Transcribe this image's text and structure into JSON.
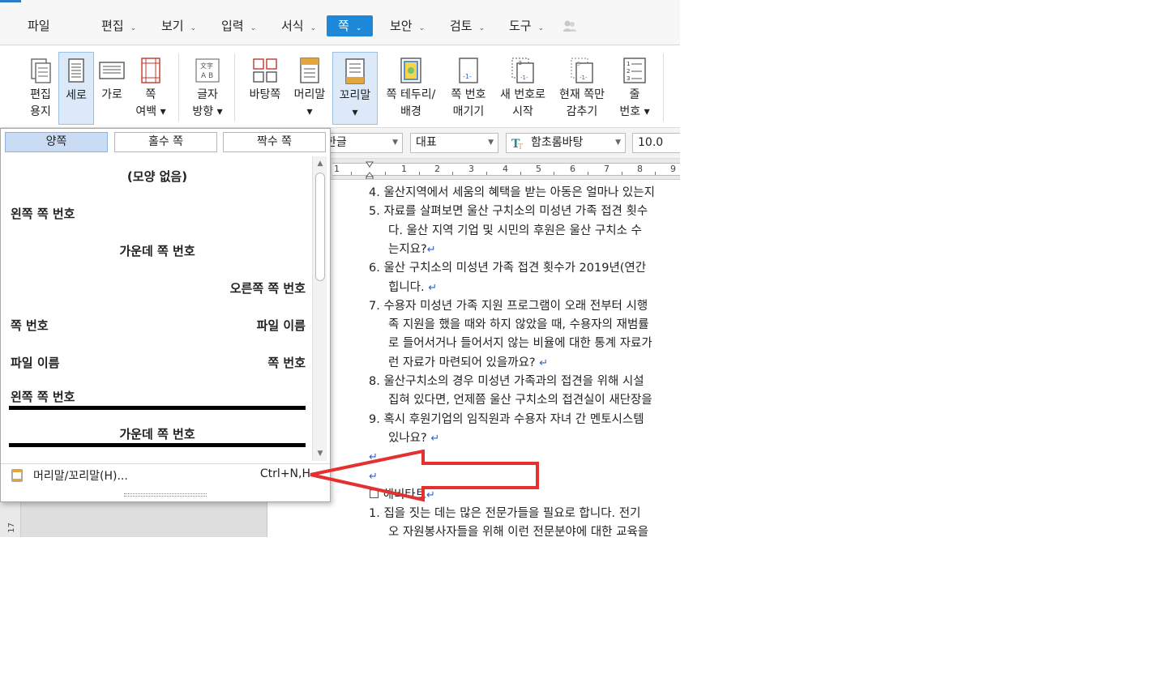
{
  "menubar": {
    "items": [
      {
        "label": "파일",
        "caret": false,
        "active": false
      },
      {
        "label": "편집",
        "caret": true,
        "active": false
      },
      {
        "label": "보기",
        "caret": true,
        "active": false
      },
      {
        "label": "입력",
        "caret": true,
        "active": false
      },
      {
        "label": "서식",
        "caret": true,
        "active": false
      },
      {
        "label": "쪽",
        "caret": true,
        "active": true
      },
      {
        "label": "보안",
        "caret": true,
        "active": false
      },
      {
        "label": "검토",
        "caret": true,
        "active": false
      },
      {
        "label": "도구",
        "caret": true,
        "active": false
      }
    ],
    "caret_glyph": "⌄",
    "accent_color": "#1e88d8"
  },
  "ribbon": {
    "buttons": [
      {
        "line1": "편집",
        "line2": "용지",
        "icon": "page-setup-icon"
      },
      {
        "line1": "세로",
        "line2": "",
        "icon": "portrait-icon",
        "active": true
      },
      {
        "line1": "가로",
        "line2": "",
        "icon": "landscape-icon"
      },
      {
        "line1": "쪽",
        "line2": "여백 ▾",
        "icon": "page-margin-icon"
      },
      {
        "line1": "글자",
        "line2": "방향 ▾",
        "icon": "text-direction-icon"
      },
      {
        "line1": "바탕쪽",
        "line2": "",
        "icon": "master-page-icon"
      },
      {
        "line1": "머리말",
        "line2": "▾",
        "icon": "header-icon"
      },
      {
        "line1": "꼬리말",
        "line2": "▾",
        "icon": "footer-icon",
        "active": true
      },
      {
        "line1": "쪽 테두리/",
        "line2": "배경",
        "icon": "page-border-icon"
      },
      {
        "line1": "쪽 번호",
        "line2": "매기기",
        "icon": "page-number-icon"
      },
      {
        "line1": "새 번호로",
        "line2": "시작",
        "icon": "new-number-icon"
      },
      {
        "line1": "현재 쪽만",
        "line2": "감추기",
        "icon": "hide-current-page-icon"
      },
      {
        "line1": "줄",
        "line2": "번호 ▾",
        "icon": "line-number-icon"
      }
    ]
  },
  "formatbar": {
    "lang": "한글",
    "style": "대표",
    "font": "함초롬바탕",
    "size": "10.0"
  },
  "ruler": {
    "numbers": [
      "1",
      "1",
      "2",
      "3",
      "4",
      "5",
      "6",
      "7",
      "8",
      "9"
    ],
    "vertical_number": "17"
  },
  "dropdown": {
    "tabs": [
      "양쪽",
      "홀수 쪽",
      "짝수 쪽"
    ],
    "active_tab": 0,
    "options": [
      {
        "left": "",
        "center": "(모양 없음)",
        "right": "",
        "line": false
      },
      {
        "left": "왼쪽 쪽 번호",
        "center": "",
        "right": "",
        "line": false
      },
      {
        "left": "",
        "center": "가운데 쪽 번호",
        "right": "",
        "line": false
      },
      {
        "left": "",
        "center": "",
        "right": "오른쪽 쪽 번호",
        "line": false
      },
      {
        "left": "쪽 번호",
        "center": "",
        "right": "파일 이름",
        "line": false
      },
      {
        "left": "파일 이름",
        "center": "",
        "right": "쪽 번호",
        "line": false
      },
      {
        "left": "왼쪽 쪽 번호",
        "center": "",
        "right": "",
        "line": true
      },
      {
        "left": "",
        "center": "가운데 쪽 번호",
        "right": "",
        "line": true
      }
    ],
    "scroll_up": "▲",
    "scroll_down": "▼",
    "header_footer_item": {
      "label": "머리말/꼬리말(H)...",
      "shortcut": "Ctrl+N,H"
    }
  },
  "document": {
    "lines": [
      {
        "indent": false,
        "text": "4.  울산지역에서 세움의 혜택을 받는 아동은 얼마나 있는지",
        "ret": false
      },
      {
        "indent": false,
        "text": "5.  자료를 살펴보면 울산 구치소의 미성년 가족 접견 횟수",
        "ret": false
      },
      {
        "indent": true,
        "text": "다. 울산 지역 기업 및 시민의 후원은 울산 구치소 수",
        "ret": false
      },
      {
        "indent": true,
        "text": "는지요?",
        "ret": true
      },
      {
        "indent": false,
        "text": "6.  울산 구치소의 미성년 가족 접견 횟수가 2019년(연간",
        "ret": false
      },
      {
        "indent": true,
        "text": "힙니다. ",
        "ret": true
      },
      {
        "indent": false,
        "text": "7.  수용자 미성년 가족 지원 프로그램이 오래 전부터 시행",
        "ret": false
      },
      {
        "indent": true,
        "text": "족 지원을 했을 때와 하지 않았을 때, 수용자의 재범률",
        "ret": false
      },
      {
        "indent": true,
        "text": "로 들어서거나 들어서지 않는 비율에 대한 통계 자료가",
        "ret": false
      },
      {
        "indent": true,
        "text": "런 자료가 마련되어 있을까요? ",
        "ret": true
      },
      {
        "indent": false,
        "text": "8.  울산구치소의 경우 미성년 가족과의 접견을 위해 시설",
        "ret": false
      },
      {
        "indent": true,
        "text": "집혀 있다면, 언제쯤 울산 구치소의 접견실이 새단장을",
        "ret": false
      },
      {
        "indent": false,
        "text": "9.  혹시 후원기업의 임직원과 수용자 자녀 간 멘토시스템",
        "ret": false
      },
      {
        "indent": true,
        "text": "있나요? ",
        "ret": true
      },
      {
        "indent": false,
        "text": "",
        "ret": true
      },
      {
        "indent": false,
        "text": "",
        "ret": true
      },
      {
        "indent": false,
        "text": "☐ 해비타트",
        "ret": true
      },
      {
        "indent": false,
        "text": "1.  집을 짓는 데는 많은 전문가들을 필요로 합니다. 전기",
        "ret": false
      },
      {
        "indent": true,
        "text": "오 자원봉사자들을 위해 이런 전문분야에 대한 교육을",
        "ret": false
      }
    ],
    "return_glyph": "↵"
  },
  "colors": {
    "active_tab_bg": "#c9dcf3",
    "arrow": "#e53030",
    "return_mark": "#2f5fd0"
  }
}
